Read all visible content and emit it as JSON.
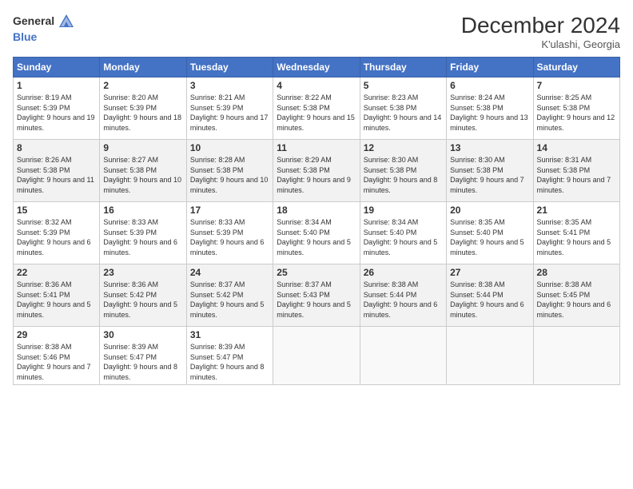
{
  "header": {
    "logo": {
      "line1": "General",
      "line2": "Blue"
    },
    "title": "December 2024",
    "subtitle": "K'ulashi, Georgia"
  },
  "weekdays": [
    "Sunday",
    "Monday",
    "Tuesday",
    "Wednesday",
    "Thursday",
    "Friday",
    "Saturday"
  ],
  "weeks": [
    [
      {
        "day": "1",
        "sunrise": "8:19 AM",
        "sunset": "5:39 PM",
        "daylight": "9 hours and 19 minutes."
      },
      {
        "day": "2",
        "sunrise": "8:20 AM",
        "sunset": "5:39 PM",
        "daylight": "9 hours and 18 minutes."
      },
      {
        "day": "3",
        "sunrise": "8:21 AM",
        "sunset": "5:39 PM",
        "daylight": "9 hours and 17 minutes."
      },
      {
        "day": "4",
        "sunrise": "8:22 AM",
        "sunset": "5:38 PM",
        "daylight": "9 hours and 15 minutes."
      },
      {
        "day": "5",
        "sunrise": "8:23 AM",
        "sunset": "5:38 PM",
        "daylight": "9 hours and 14 minutes."
      },
      {
        "day": "6",
        "sunrise": "8:24 AM",
        "sunset": "5:38 PM",
        "daylight": "9 hours and 13 minutes."
      },
      {
        "day": "7",
        "sunrise": "8:25 AM",
        "sunset": "5:38 PM",
        "daylight": "9 hours and 12 minutes."
      }
    ],
    [
      {
        "day": "8",
        "sunrise": "8:26 AM",
        "sunset": "5:38 PM",
        "daylight": "9 hours and 11 minutes."
      },
      {
        "day": "9",
        "sunrise": "8:27 AM",
        "sunset": "5:38 PM",
        "daylight": "9 hours and 10 minutes."
      },
      {
        "day": "10",
        "sunrise": "8:28 AM",
        "sunset": "5:38 PM",
        "daylight": "9 hours and 10 minutes."
      },
      {
        "day": "11",
        "sunrise": "8:29 AM",
        "sunset": "5:38 PM",
        "daylight": "9 hours and 9 minutes."
      },
      {
        "day": "12",
        "sunrise": "8:30 AM",
        "sunset": "5:38 PM",
        "daylight": "9 hours and 8 minutes."
      },
      {
        "day": "13",
        "sunrise": "8:30 AM",
        "sunset": "5:38 PM",
        "daylight": "9 hours and 7 minutes."
      },
      {
        "day": "14",
        "sunrise": "8:31 AM",
        "sunset": "5:38 PM",
        "daylight": "9 hours and 7 minutes."
      }
    ],
    [
      {
        "day": "15",
        "sunrise": "8:32 AM",
        "sunset": "5:39 PM",
        "daylight": "9 hours and 6 minutes."
      },
      {
        "day": "16",
        "sunrise": "8:33 AM",
        "sunset": "5:39 PM",
        "daylight": "9 hours and 6 minutes."
      },
      {
        "day": "17",
        "sunrise": "8:33 AM",
        "sunset": "5:39 PM",
        "daylight": "9 hours and 6 minutes."
      },
      {
        "day": "18",
        "sunrise": "8:34 AM",
        "sunset": "5:40 PM",
        "daylight": "9 hours and 5 minutes."
      },
      {
        "day": "19",
        "sunrise": "8:34 AM",
        "sunset": "5:40 PM",
        "daylight": "9 hours and 5 minutes."
      },
      {
        "day": "20",
        "sunrise": "8:35 AM",
        "sunset": "5:40 PM",
        "daylight": "9 hours and 5 minutes."
      },
      {
        "day": "21",
        "sunrise": "8:35 AM",
        "sunset": "5:41 PM",
        "daylight": "9 hours and 5 minutes."
      }
    ],
    [
      {
        "day": "22",
        "sunrise": "8:36 AM",
        "sunset": "5:41 PM",
        "daylight": "9 hours and 5 minutes."
      },
      {
        "day": "23",
        "sunrise": "8:36 AM",
        "sunset": "5:42 PM",
        "daylight": "9 hours and 5 minutes."
      },
      {
        "day": "24",
        "sunrise": "8:37 AM",
        "sunset": "5:42 PM",
        "daylight": "9 hours and 5 minutes."
      },
      {
        "day": "25",
        "sunrise": "8:37 AM",
        "sunset": "5:43 PM",
        "daylight": "9 hours and 5 minutes."
      },
      {
        "day": "26",
        "sunrise": "8:38 AM",
        "sunset": "5:44 PM",
        "daylight": "9 hours and 6 minutes."
      },
      {
        "day": "27",
        "sunrise": "8:38 AM",
        "sunset": "5:44 PM",
        "daylight": "9 hours and 6 minutes."
      },
      {
        "day": "28",
        "sunrise": "8:38 AM",
        "sunset": "5:45 PM",
        "daylight": "9 hours and 6 minutes."
      }
    ],
    [
      {
        "day": "29",
        "sunrise": "8:38 AM",
        "sunset": "5:46 PM",
        "daylight": "9 hours and 7 minutes."
      },
      {
        "day": "30",
        "sunrise": "8:39 AM",
        "sunset": "5:47 PM",
        "daylight": "9 hours and 8 minutes."
      },
      {
        "day": "31",
        "sunrise": "8:39 AM",
        "sunset": "5:47 PM",
        "daylight": "9 hours and 8 minutes."
      },
      null,
      null,
      null,
      null
    ]
  ]
}
